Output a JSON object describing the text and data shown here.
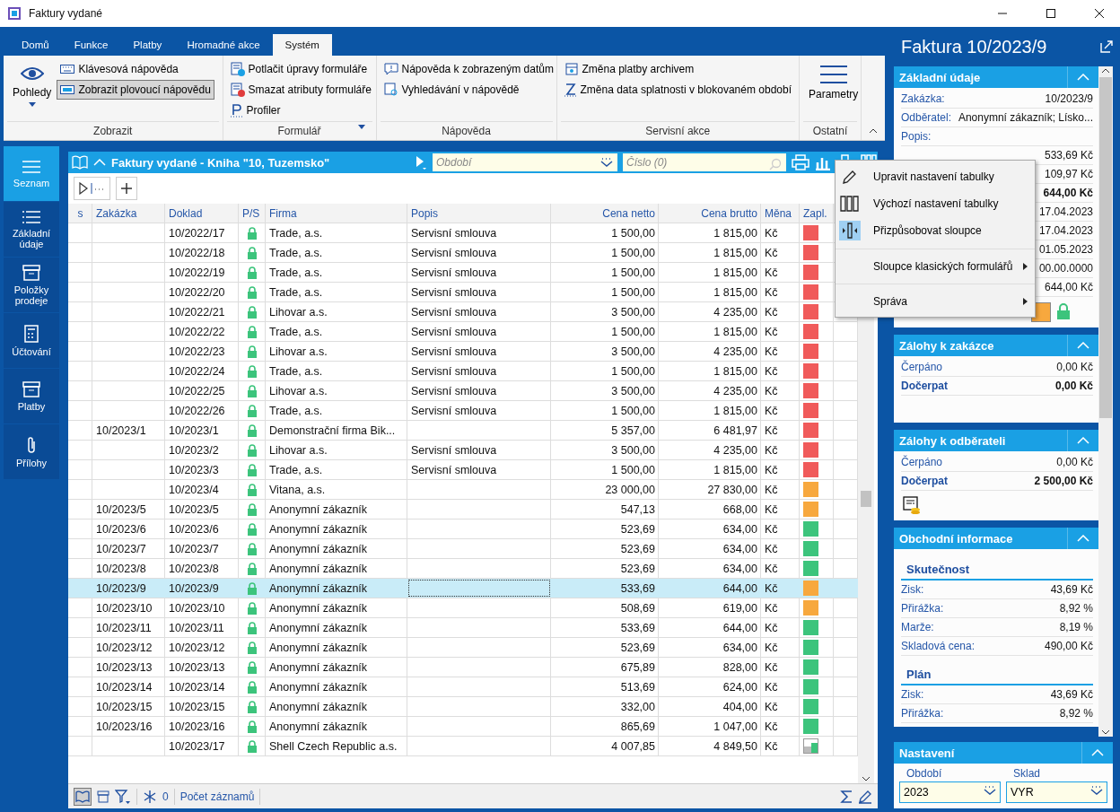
{
  "window": {
    "title": "Faktury vydané"
  },
  "ribbon": {
    "tabs": [
      {
        "label": "Domů",
        "selected": false
      },
      {
        "label": "Funkce",
        "selected": false
      },
      {
        "label": "Platby",
        "selected": false
      },
      {
        "label": "Hromadné akce",
        "selected": false
      },
      {
        "label": "Systém",
        "selected": true
      }
    ],
    "groups": [
      {
        "label": "Zobrazit",
        "dropdown": false,
        "items": [
          {
            "kind": "large",
            "label": "Pohledy",
            "pressed": false
          },
          {
            "kind": "small",
            "label": "Klávesová nápověda",
            "pressed": false
          },
          {
            "kind": "small",
            "label": "Zobrazit plovoucí nápovědu",
            "pressed": true
          }
        ]
      },
      {
        "label": "Formulář",
        "dropdown": true,
        "items": [
          {
            "kind": "small",
            "label": "Potlačit úpravy formuláře",
            "pressed": false
          },
          {
            "kind": "small",
            "label": "Smazat atributy formuláře",
            "pressed": false
          },
          {
            "kind": "small",
            "label": "Profiler",
            "pressed": false
          }
        ]
      },
      {
        "label": "Nápověda",
        "dropdown": false,
        "items": [
          {
            "kind": "small",
            "label": "Nápověda k zobrazeným datům",
            "pressed": false
          },
          {
            "kind": "small",
            "label": "Vyhledávání v nápovědě",
            "pressed": false
          }
        ]
      },
      {
        "label": "Servisní akce",
        "dropdown": false,
        "items": [
          {
            "kind": "small",
            "label": "Změna platby archivem",
            "pressed": false
          },
          {
            "kind": "small",
            "label": "Změna data splatnosti v blokovaném období",
            "pressed": false
          }
        ]
      },
      {
        "label": "Ostatní",
        "dropdown": false,
        "items": [
          {
            "kind": "large",
            "label": "Parametry",
            "pressed": false
          }
        ]
      }
    ]
  },
  "nav": [
    {
      "label": "Seznam",
      "selected": true
    },
    {
      "label": "Základní údaje",
      "selected": false
    },
    {
      "label": "Položky prodeje",
      "selected": false
    },
    {
      "label": "Účtování",
      "selected": false
    },
    {
      "label": "Platby",
      "selected": false
    },
    {
      "label": "Přílohy",
      "selected": false
    }
  ],
  "list": {
    "title": "Faktury vydané - Kniha \"10, Tuzemsko\"",
    "period_placeholder": "Období",
    "number_placeholder": "Číslo (0)",
    "columns": [
      "s",
      "Zakázka",
      "Doklad",
      "P/S",
      "Firma",
      "Popis",
      "Cena netto",
      "Cena brutto",
      "Měna",
      "Zapl."
    ],
    "rows": [
      {
        "order": "",
        "doc": "10/2022/17",
        "firm": "Trade, a.s.",
        "desc": "Servisní smlouva",
        "net": "1 500,00",
        "gross": "1 815,00",
        "cur": "Kč",
        "locked": true,
        "color": "#f05a5a",
        "partial": false,
        "selected": false
      },
      {
        "order": "",
        "doc": "10/2022/18",
        "firm": "Trade, a.s.",
        "desc": "Servisní smlouva",
        "net": "1 500,00",
        "gross": "1 815,00",
        "cur": "Kč",
        "locked": true,
        "color": "#f05a5a",
        "partial": false,
        "selected": false
      },
      {
        "order": "",
        "doc": "10/2022/19",
        "firm": "Trade, a.s.",
        "desc": "Servisní smlouva",
        "net": "1 500,00",
        "gross": "1 815,00",
        "cur": "Kč",
        "locked": true,
        "color": "#f05a5a",
        "partial": false,
        "selected": false
      },
      {
        "order": "",
        "doc": "10/2022/20",
        "firm": "Trade, a.s.",
        "desc": "Servisní smlouva",
        "net": "1 500,00",
        "gross": "1 815,00",
        "cur": "Kč",
        "locked": true,
        "color": "#f05a5a",
        "partial": false,
        "selected": false
      },
      {
        "order": "",
        "doc": "10/2022/21",
        "firm": "Lihovar a.s.",
        "desc": "Servisní smlouva",
        "net": "3 500,00",
        "gross": "4 235,00",
        "cur": "Kč",
        "locked": true,
        "color": "#f05a5a",
        "partial": false,
        "selected": false
      },
      {
        "order": "",
        "doc": "10/2022/22",
        "firm": "Trade, a.s.",
        "desc": "Servisní smlouva",
        "net": "1 500,00",
        "gross": "1 815,00",
        "cur": "Kč",
        "locked": true,
        "color": "#f05a5a",
        "partial": false,
        "selected": false
      },
      {
        "order": "",
        "doc": "10/2022/23",
        "firm": "Lihovar a.s.",
        "desc": "Servisní smlouva",
        "net": "3 500,00",
        "gross": "4 235,00",
        "cur": "Kč",
        "locked": true,
        "color": "#f05a5a",
        "partial": false,
        "selected": false
      },
      {
        "order": "",
        "doc": "10/2022/24",
        "firm": "Trade, a.s.",
        "desc": "Servisní smlouva",
        "net": "1 500,00",
        "gross": "1 815,00",
        "cur": "Kč",
        "locked": true,
        "color": "#f05a5a",
        "partial": false,
        "selected": false
      },
      {
        "order": "",
        "doc": "10/2022/25",
        "firm": "Lihovar a.s.",
        "desc": "Servisní smlouva",
        "net": "3 500,00",
        "gross": "4 235,00",
        "cur": "Kč",
        "locked": true,
        "color": "#f05a5a",
        "partial": false,
        "selected": false
      },
      {
        "order": "",
        "doc": "10/2022/26",
        "firm": "Trade, a.s.",
        "desc": "Servisní smlouva",
        "net": "1 500,00",
        "gross": "1 815,00",
        "cur": "Kč",
        "locked": true,
        "color": "#f05a5a",
        "partial": false,
        "selected": false
      },
      {
        "order": "10/2023/1",
        "doc": "10/2023/1",
        "firm": "Demonstrační firma Bik...",
        "desc": "",
        "net": "5 357,00",
        "gross": "6 481,97",
        "cur": "Kč",
        "locked": true,
        "color": "#f05a5a",
        "partial": false,
        "selected": false
      },
      {
        "order": "",
        "doc": "10/2023/2",
        "firm": "Lihovar a.s.",
        "desc": "Servisní smlouva",
        "net": "3 500,00",
        "gross": "4 235,00",
        "cur": "Kč",
        "locked": true,
        "color": "#f05a5a",
        "partial": false,
        "selected": false
      },
      {
        "order": "",
        "doc": "10/2023/3",
        "firm": "Trade, a.s.",
        "desc": "Servisní smlouva",
        "net": "1 500,00",
        "gross": "1 815,00",
        "cur": "Kč",
        "locked": true,
        "color": "#f05a5a",
        "partial": false,
        "selected": false
      },
      {
        "order": "",
        "doc": "10/2023/4",
        "firm": "Vitana, a.s.",
        "desc": "",
        "net": "23 000,00",
        "gross": "27 830,00",
        "cur": "Kč",
        "locked": true,
        "color": "#f7a83e",
        "partial": false,
        "selected": false
      },
      {
        "order": "10/2023/5",
        "doc": "10/2023/5",
        "firm": "Anonymní zákazník",
        "desc": "",
        "net": "547,13",
        "gross": "668,00",
        "cur": "Kč",
        "locked": true,
        "color": "#f7a83e",
        "partial": false,
        "selected": false
      },
      {
        "order": "10/2023/6",
        "doc": "10/2023/6",
        "firm": "Anonymní zákazník",
        "desc": "",
        "net": "523,69",
        "gross": "634,00",
        "cur": "Kč",
        "locked": true,
        "color": "#3cc47c",
        "partial": false,
        "selected": false
      },
      {
        "order": "10/2023/7",
        "doc": "10/2023/7",
        "firm": "Anonymní zákazník",
        "desc": "",
        "net": "523,69",
        "gross": "634,00",
        "cur": "Kč",
        "locked": true,
        "color": "#3cc47c",
        "partial": false,
        "selected": false
      },
      {
        "order": "10/2023/8",
        "doc": "10/2023/8",
        "firm": "Anonymní zákazník",
        "desc": "",
        "net": "523,69",
        "gross": "634,00",
        "cur": "Kč",
        "locked": true,
        "color": "#3cc47c",
        "partial": false,
        "selected": false
      },
      {
        "order": "10/2023/9",
        "doc": "10/2023/9",
        "firm": "Anonymní zákazník",
        "desc": "",
        "net": "533,69",
        "gross": "644,00",
        "cur": "Kč",
        "locked": true,
        "color": "#f7a83e",
        "partial": false,
        "selected": true
      },
      {
        "order": "10/2023/10",
        "doc": "10/2023/10",
        "firm": "Anonymní zákazník",
        "desc": "",
        "net": "508,69",
        "gross": "619,00",
        "cur": "Kč",
        "locked": true,
        "color": "#f7a83e",
        "partial": false,
        "selected": false
      },
      {
        "order": "10/2023/11",
        "doc": "10/2023/11",
        "firm": "Anonymní zákazník",
        "desc": "",
        "net": "533,69",
        "gross": "644,00",
        "cur": "Kč",
        "locked": true,
        "color": "#3cc47c",
        "partial": false,
        "selected": false
      },
      {
        "order": "10/2023/12",
        "doc": "10/2023/12",
        "firm": "Anonymní zákazník",
        "desc": "",
        "net": "523,69",
        "gross": "634,00",
        "cur": "Kč",
        "locked": true,
        "color": "#3cc47c",
        "partial": false,
        "selected": false
      },
      {
        "order": "10/2023/13",
        "doc": "10/2023/13",
        "firm": "Anonymní zákazník",
        "desc": "",
        "net": "675,89",
        "gross": "828,00",
        "cur": "Kč",
        "locked": true,
        "color": "#3cc47c",
        "partial": false,
        "selected": false
      },
      {
        "order": "10/2023/14",
        "doc": "10/2023/14",
        "firm": "Anonymní zákazník",
        "desc": "",
        "net": "513,69",
        "gross": "624,00",
        "cur": "Kč",
        "locked": true,
        "color": "#3cc47c",
        "partial": false,
        "selected": false
      },
      {
        "order": "10/2023/15",
        "doc": "10/2023/15",
        "firm": "Anonymní zákazník",
        "desc": "",
        "net": "332,00",
        "gross": "404,00",
        "cur": "Kč",
        "locked": true,
        "color": "#3cc47c",
        "partial": false,
        "selected": false
      },
      {
        "order": "10/2023/16",
        "doc": "10/2023/16",
        "firm": "Anonymní zákazník",
        "desc": "",
        "net": "865,69",
        "gross": "1 047,00",
        "cur": "Kč",
        "locked": true,
        "color": "#3cc47c",
        "partial": false,
        "selected": false
      },
      {
        "order": "",
        "doc": "10/2023/17",
        "firm": "Shell Czech Republic a.s.",
        "desc": "",
        "net": "4 007,85",
        "gross": "4 849,50",
        "cur": "Kč",
        "locked": true,
        "color": "#3cc47c",
        "partial": true,
        "selected": false
      }
    ],
    "footer": {
      "count": "0",
      "records_label": "Počet záznamů"
    }
  },
  "context_menu": [
    {
      "label": "Upravit nastavení tabulky",
      "checked": false,
      "submenu": false,
      "separator_before": false
    },
    {
      "label": "Výchozí nastavení tabulky",
      "checked": false,
      "submenu": false,
      "separator_before": false
    },
    {
      "label": "Přizpůsobovat sloupce",
      "checked": true,
      "submenu": false,
      "separator_before": false
    },
    {
      "label": "Sloupce klasických formulářů",
      "checked": false,
      "submenu": true,
      "separator_before": true
    },
    {
      "label": "Správa",
      "checked": false,
      "submenu": true,
      "separator_before": true
    }
  ],
  "detail": {
    "title": "Faktura 10/2023/9",
    "sections": [
      {
        "title": "Základní údaje",
        "rows": [
          {
            "kind": "row",
            "label": "Zakázka:",
            "value": "10/2023/9",
            "bold": false
          },
          {
            "kind": "row",
            "label": "Odběratel:",
            "value": "Anonymní zákazník; Lísko...",
            "bold": false
          },
          {
            "kind": "row",
            "label": "Popis:",
            "value": "",
            "bold": false
          },
          {
            "kind": "row",
            "label": "",
            "value": "533,69 Kč",
            "bold": false
          },
          {
            "kind": "row",
            "label": "",
            "value": "109,97 Kč",
            "bold": false
          },
          {
            "kind": "row",
            "label": "",
            "value": "644,00 Kč",
            "bold": true
          },
          {
            "kind": "row",
            "label": "",
            "value": "17.04.2023",
            "bold": false
          },
          {
            "kind": "row",
            "label": "",
            "value": "17.04.2023",
            "bold": false
          },
          {
            "kind": "row",
            "label": "",
            "value": "01.05.2023",
            "bold": false
          },
          {
            "kind": "row",
            "label": "",
            "value": "00.00.0000",
            "bold": false
          },
          {
            "kind": "row",
            "label": "",
            "value": "644,00 Kč",
            "bold": false
          },
          {
            "kind": "status",
            "color": "#f7a83e",
            "locked": true
          }
        ]
      },
      {
        "title": "Zálohy k zakázce",
        "rows": [
          {
            "kind": "row",
            "label": "Čerpáno",
            "value": "0,00 Kč",
            "bold": false
          },
          {
            "kind": "row",
            "label": "Dočerpat",
            "value": "0,00 Kč",
            "bold": true
          },
          {
            "kind": "spacer"
          }
        ]
      },
      {
        "title": "Zálohy k odběrateli",
        "rows": [
          {
            "kind": "row",
            "label": "Čerpáno",
            "value": "0,00 Kč",
            "bold": false
          },
          {
            "kind": "row",
            "label": "Dočerpat",
            "value": "2 500,00 Kč",
            "bold": true
          },
          {
            "kind": "doc-icon"
          }
        ]
      },
      {
        "title": "Obchodní informace",
        "rows": [
          {
            "kind": "heading",
            "label": "Skutečnost"
          },
          {
            "kind": "row",
            "label": "Zisk:",
            "value": "43,69 Kč",
            "bold": false
          },
          {
            "kind": "row",
            "label": "Přirážka:",
            "value": "8,92 %",
            "bold": false
          },
          {
            "kind": "row",
            "label": "Marže:",
            "value": "8,19 %",
            "bold": false
          },
          {
            "kind": "row",
            "label": "Skladová cena:",
            "value": "490,00 Kč",
            "bold": false
          },
          {
            "kind": "heading",
            "label": "Plán"
          },
          {
            "kind": "row",
            "label": "Zisk:",
            "value": "43,69 Kč",
            "bold": false
          },
          {
            "kind": "row",
            "label": "Přirážka:",
            "value": "8,92 %",
            "bold": false
          }
        ]
      }
    ],
    "settings": {
      "title": "Nastavení",
      "fields": [
        {
          "label": "Období",
          "value": "2023"
        },
        {
          "label": "Sklad",
          "value": "VYR"
        }
      ]
    }
  }
}
